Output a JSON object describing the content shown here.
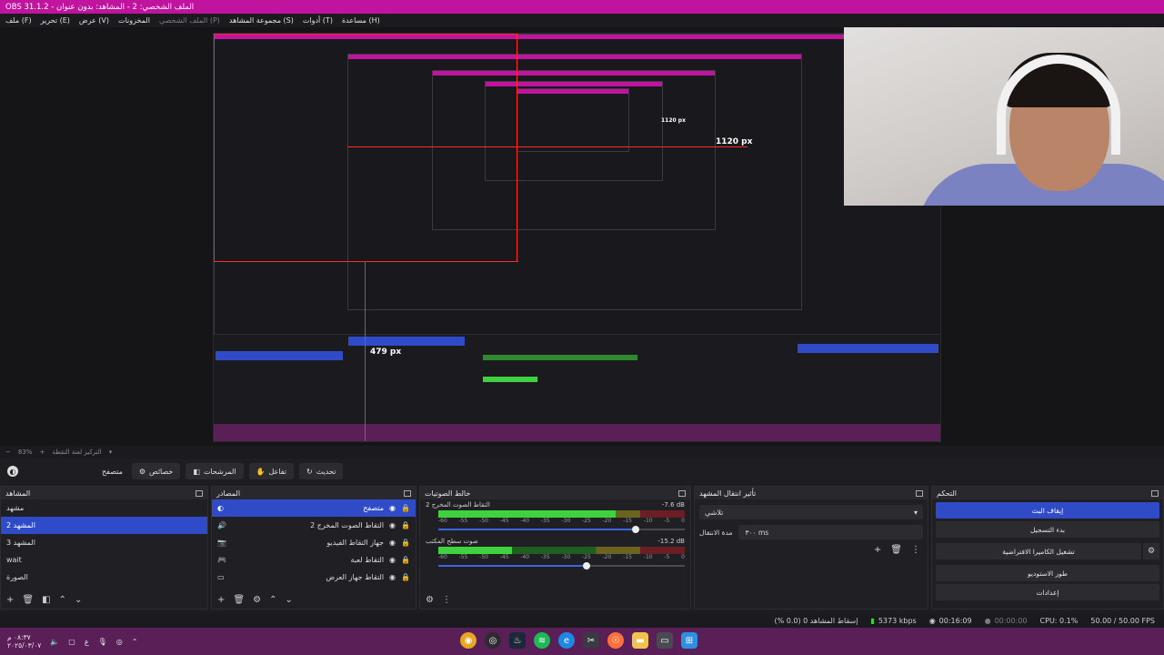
{
  "window": {
    "title": "OBS 31.1.2 - الملف الشخصي: 2 - المشاهد: بدون عنوان"
  },
  "menu": {
    "items": [
      "ملف (F)",
      "تحرير (E)",
      "عرض (V)",
      "المخزونات",
      "الملف الشخصي (P)",
      "مجموعة المشاهد (S)",
      "أدوات (T)",
      "مساعدة (H)"
    ]
  },
  "preview": {
    "px_label_1": "1120 px",
    "px_label_2": "1120 px",
    "px_label_3": "479 px"
  },
  "zoom": {
    "level": "83%",
    "hint": "التركيز لعنة التقطة"
  },
  "toolbar": {
    "source_name": "متصفح",
    "properties_label": "خصائص",
    "filters_label": "المرشحات",
    "interact_label": "تفاعل",
    "refresh_label": "تحديث"
  },
  "scenes": {
    "title": "المشاهد",
    "items": [
      "مشهد",
      "المشهد 2",
      "المشهد 3",
      "wait",
      "الصورة"
    ],
    "selected_index": 1
  },
  "sources": {
    "title": "المصادر",
    "items": [
      {
        "name": "متصفح",
        "icon": "browser-icon"
      },
      {
        "name": "التقاط الصوت المخرج 2",
        "icon": "speaker-icon"
      },
      {
        "name": "جهاز التقاط الفيديو",
        "icon": "camera-icon"
      },
      {
        "name": "التقاط لعبة",
        "icon": "gamepad-icon"
      },
      {
        "name": "التقاط جهاز العرض",
        "icon": "monitor-icon"
      }
    ],
    "selected_index": 0
  },
  "mixer": {
    "title": "خالط الصوتيات",
    "channels": [
      {
        "name": "التقاط الصوت المخرج 2",
        "db": "-7.6 dB",
        "level": 0.72,
        "volume": 0.8
      },
      {
        "name": "صوت سطح المكتب",
        "db": "-15.2 dB",
        "level": 0.3,
        "volume": 0.6
      }
    ],
    "ticks": [
      "-60",
      "-55",
      "-50",
      "-45",
      "-40",
      "-35",
      "-30",
      "-25",
      "-20",
      "-15",
      "-10",
      "-5",
      "0"
    ]
  },
  "transitions": {
    "title": "تأثير انتقال المشهد",
    "selected": "تلاشي",
    "duration_label": "مدة الانتقال",
    "duration_value": "٣٠٠ ms"
  },
  "controls": {
    "title": "التحكم",
    "buttons": [
      "إيقاف البث",
      "بدء التسجيل",
      "تشغيل الكاميرا الافتراضية",
      "طور الاستوديو",
      "إعدادات"
    ]
  },
  "status": {
    "dropped": "إسقاط المشاهد 0 (0.0 %)",
    "bitrate": "5373 kbps",
    "stream_time": "00:16:09",
    "rec_time": "00:00:00",
    "cpu": "CPU: 0.1%",
    "fps": "50.00 / 50.00 FPS"
  },
  "taskbar": {
    "time": "٠٨:٣٧ م",
    "date": "٢٠٢٥/٠٣/٠٧",
    "lang": "ع"
  },
  "colors": {
    "accent": "#2f4bc7",
    "titlebar": "#c1149e",
    "taskbar": "#5a1f56"
  }
}
